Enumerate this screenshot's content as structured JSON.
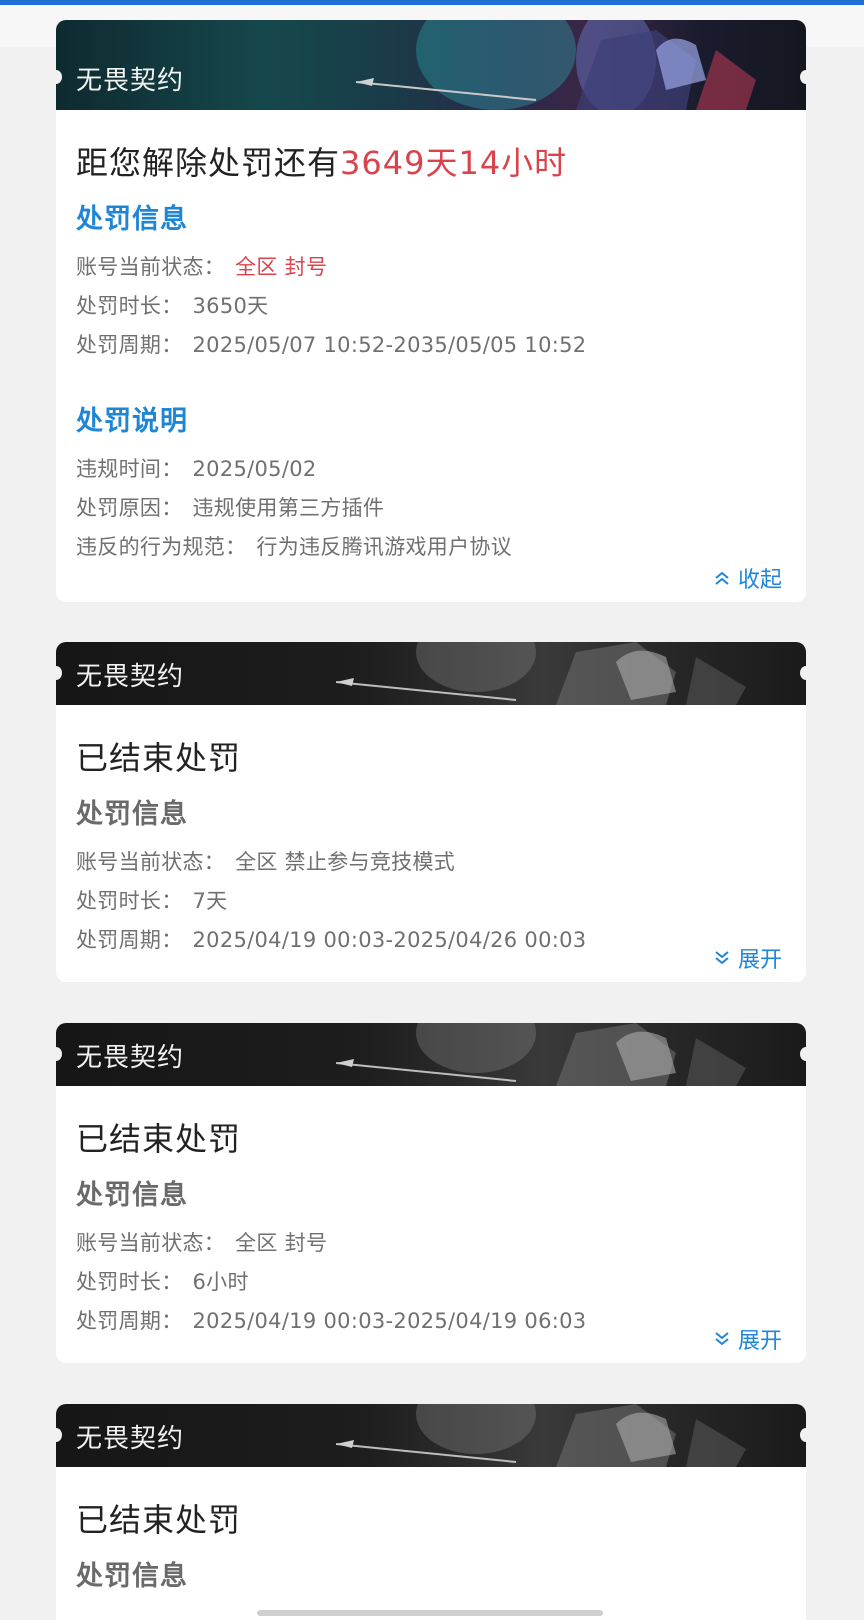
{
  "cards": [
    {
      "banner_title": "无畏契约",
      "status_prefix": "距您解除处罚还有",
      "countdown": "3649天14小时",
      "info_title": "处罚信息",
      "info_rows": [
        {
          "label": "账号当前状态：",
          "value": "全区 封号"
        },
        {
          "label": "处罚时长：",
          "value": "3650天"
        },
        {
          "label": "处罚周期：",
          "value": "2025/05/07 10:52-2035/05/05 10:52"
        }
      ],
      "desc_title": "处罚说明",
      "desc_rows": [
        {
          "label": "违规时间：",
          "value": "2025/05/02"
        },
        {
          "label": "处罚原因：",
          "value": "违规使用第三方插件"
        },
        {
          "label": "违反的行为规范：",
          "value": "行为违反腾讯游戏用户协议"
        }
      ],
      "toggle_label": "收起"
    },
    {
      "banner_title": "无畏契约",
      "status": "已结束处罚",
      "info_title": "处罚信息",
      "info_rows": [
        {
          "label": "账号当前状态：",
          "value": "全区 禁止参与竞技模式"
        },
        {
          "label": "处罚时长：",
          "value": "7天"
        },
        {
          "label": "处罚周期：",
          "value": "2025/04/19 00:03-2025/04/26 00:03"
        }
      ],
      "toggle_label": "展开"
    },
    {
      "banner_title": "无畏契约",
      "status": "已结束处罚",
      "info_title": "处罚信息",
      "info_rows": [
        {
          "label": "账号当前状态：",
          "value": "全区 封号"
        },
        {
          "label": "处罚时长：",
          "value": "6小时"
        },
        {
          "label": "处罚周期：",
          "value": "2025/04/19 00:03-2025/04/19 06:03"
        }
      ],
      "toggle_label": "展开"
    },
    {
      "banner_title": "无畏契约",
      "status": "已结束处罚",
      "info_title": "处罚信息"
    }
  ],
  "colors": {
    "accent_blue": "#1f86d6",
    "alert_red": "#d9444c",
    "top_accent": "#1e6fd6"
  },
  "icons": {
    "collapse": "double-chevron-up-icon",
    "expand": "double-chevron-down-icon"
  }
}
